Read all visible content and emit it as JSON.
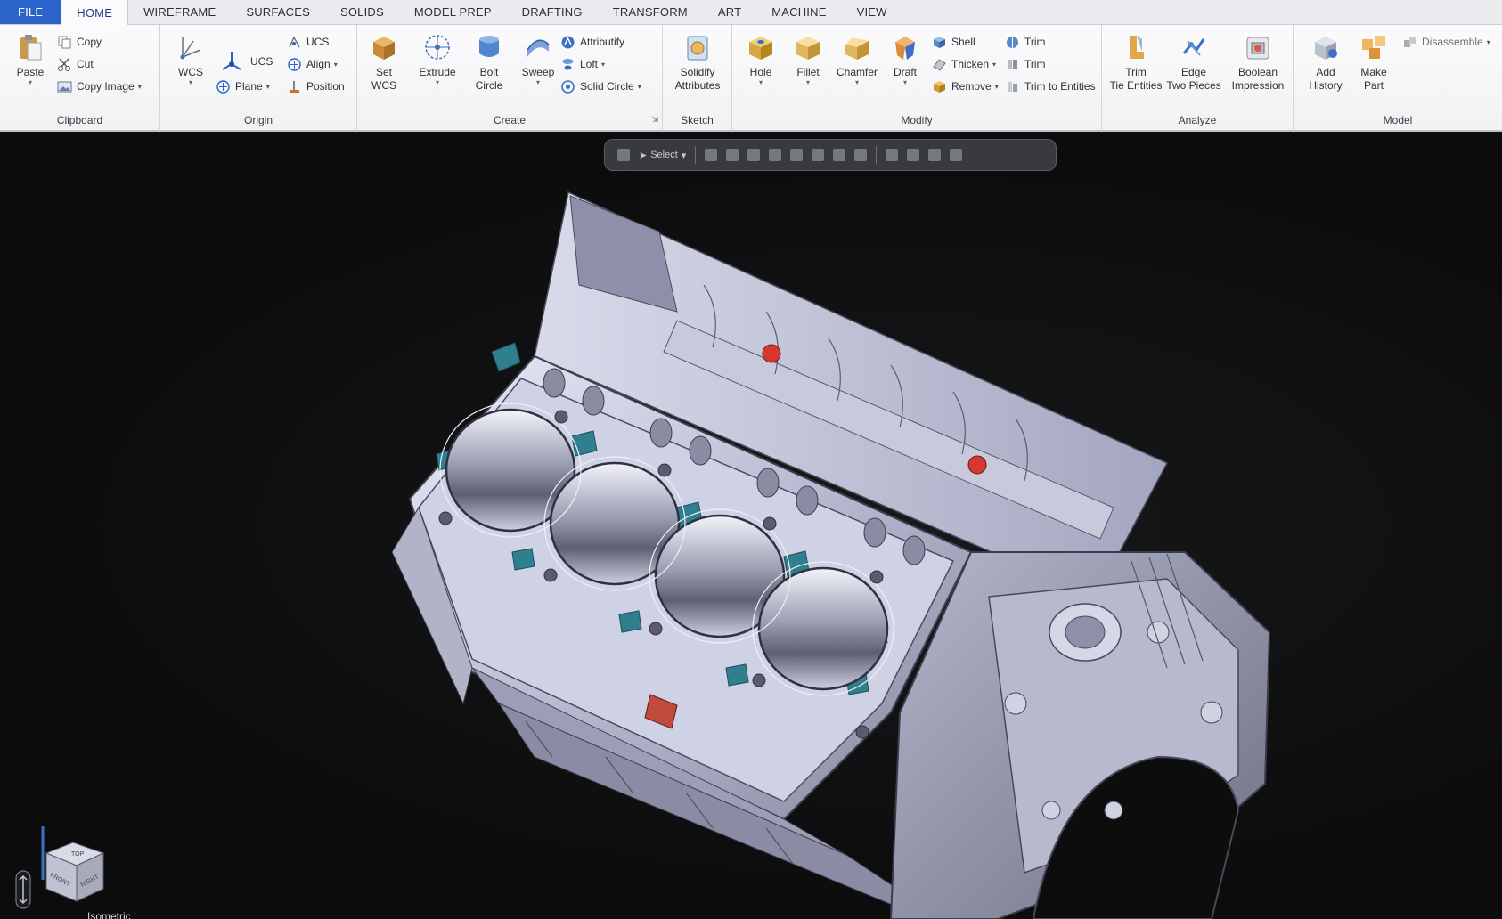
{
  "menu": {
    "tabs": [
      "FILE",
      "HOME",
      "WIREFRAME",
      "SURFACES",
      "SOLIDS",
      "MODEL PREP",
      "DRAFTING",
      "TRANSFORM",
      "ART",
      "MACHINE",
      "VIEW"
    ],
    "active_index": 1
  },
  "ribbon": {
    "clipboard": {
      "label": "Clipboard",
      "paste": "Paste",
      "copy": "Copy",
      "cut": "Cut",
      "copy_image": "Copy Image"
    },
    "origin": {
      "label": "Origin",
      "wcs": "WCS",
      "ucs_big": "UCS",
      "ucs": "UCS",
      "align": "Align",
      "plane": "Plane",
      "position": "Position"
    },
    "create": {
      "label": "Create",
      "set_wcs_1": "Set",
      "set_wcs_2": "WCS",
      "extrude": "Extrude",
      "bolt_1": "Bolt",
      "bolt_2": "Circle",
      "sweep": "Sweep",
      "attributify": "Attributify",
      "loft": "Loft",
      "solid_circle": "Solid Circle"
    },
    "sketch": {
      "label": "Sketch",
      "solidify_1": "Solidify",
      "solidify_2": "Attributes"
    },
    "modify": {
      "label": "Modify",
      "hole": "Hole",
      "fillet": "Fillet",
      "chamfer": "Chamfer",
      "draft": "Draft",
      "shell": "Shell",
      "thicken": "Thicken",
      "remove": "Remove",
      "trim_big": "Trim",
      "trim": "Trim",
      "trim_to_entities": "Trim to Entities"
    },
    "analyze": {
      "label": "Analyze",
      "trim_1": "Trim",
      "trim_2": "Tie Entities",
      "edge_1": "Edge",
      "edge_2": "Two Pieces",
      "boolean_1": "Boolean",
      "boolean_2": "Impression"
    },
    "model": {
      "label": "Model",
      "add_history_1": "Add",
      "add_history_2": "History",
      "make_part_1": "Make",
      "make_part_2": "Part",
      "disassemble": "Disassemble"
    }
  },
  "viewport": {
    "selector": "Select",
    "view_name": "Isometric",
    "cube": {
      "top": "TOP",
      "front": "FRONT",
      "right": "RIGHT"
    },
    "colors": {
      "background": "#0d0d0e",
      "part": "#c9cbe0",
      "accent": "#2f7f8f"
    }
  }
}
